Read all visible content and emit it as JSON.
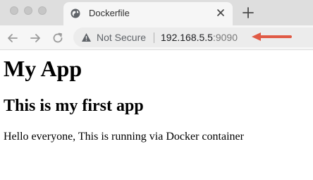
{
  "browser": {
    "tab": {
      "title": "Dockerfile"
    },
    "address_bar": {
      "security_label": "Not Secure",
      "url_host": "192.168.5.5",
      "url_port": ":9090"
    },
    "annotation_arrow_color": "#e05a45"
  },
  "page": {
    "heading": "My App",
    "subheading": "This is my first app",
    "body_text": "Hello everyone, This is running via Docker container"
  }
}
